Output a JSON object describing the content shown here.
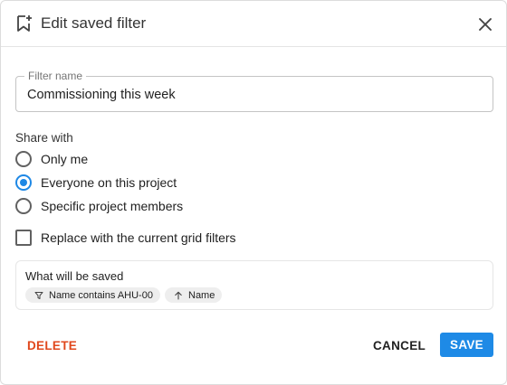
{
  "dialog": {
    "title": "Edit saved filter",
    "title_icon": "bookmark-add-icon",
    "close_icon": "close-icon"
  },
  "filter_name": {
    "label": "Filter name",
    "value": "Commissioning this week"
  },
  "share": {
    "label": "Share with",
    "options": [
      {
        "label": "Only me",
        "checked": false
      },
      {
        "label": "Everyone on this project",
        "checked": true
      },
      {
        "label": "Specific project members",
        "checked": false
      }
    ]
  },
  "replace": {
    "label": "Replace with the current grid filters",
    "checked": false
  },
  "saved": {
    "title": "What will be saved",
    "chips": [
      {
        "icon": "filter-icon",
        "label": "Name contains AHU-00"
      },
      {
        "icon": "arrow-up-icon",
        "label": "Name"
      }
    ]
  },
  "actions": {
    "delete_label": "DELETE",
    "cancel_label": "CANCEL",
    "save_label": "SAVE"
  },
  "colors": {
    "accent": "#1e88e5",
    "danger": "#e0471c",
    "save_button": "#1e8ae6"
  }
}
